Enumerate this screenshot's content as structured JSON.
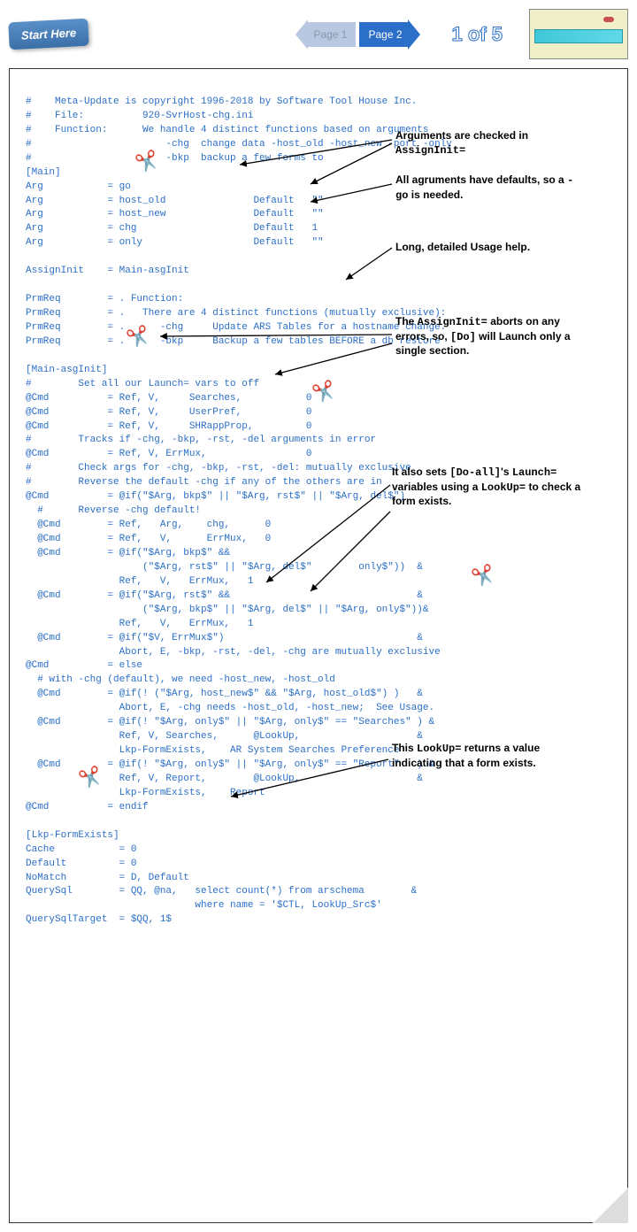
{
  "header": {
    "start_label": "Start Here",
    "page1_label": "Page 1",
    "page2_label": "Page 2",
    "counter": "1 of 5"
  },
  "code": "#    Meta-Update is copyright 1996-2018 by Software Tool House Inc.\n#    File:          920-SvrHost-chg.ini\n#    Function:      We handle 4 distinct functions based on arguments\n#                       -chg  change data -host_old -host_new -port -only\n#                       -bkp  backup a few forms to\n[Main]\nArg           = go\nArg           = host_old               Default   \"\"\nArg           = host_new               Default   \"\"\nArg           = chg                    Default   1\nArg           = only                   Default   \"\"\n\nAssignInit    = Main-asgInit\n\nPrmReq        = . Function:\nPrmReq        = .   There are 4 distinct functions (mutually exclusive):\nPrmReq        = .      -chg     Update ARS Tables for a hostname change.\nPrmReq        = .      -bkp     Backup a few tables BEFORE a db restore\n\n[Main-asgInit]\n#        Set all our Launch= vars to off\n@Cmd          = Ref, V,     Searches,           0\n@Cmd          = Ref, V,     UserPref,           0\n@Cmd          = Ref, V,     SHRappProp,         0\n#        Tracks if -chg, -bkp, -rst, -del arguments in error\n@Cmd          = Ref, V, ErrMux,                 0\n#        Check args for -chg, -bkp, -rst, -del: mutually exclusive\n#        Reverse the default -chg if any of the others are in\n@Cmd          = @if(\"$Arg, bkp$\" || \"$Arg, rst$\" || \"$Arg, del$\")\n  #      Reverse -chg default!\n  @Cmd        = Ref,   Arg,    chg,      0\n  @Cmd        = Ref,   V,      ErrMux,   0\n  @Cmd        = @if(\"$Arg, bkp$\" &&\n                    (\"$Arg, rst$\" || \"$Arg, del$\"        only$\"))  &\n                Ref,   V,   ErrMux,   1\n  @Cmd        = @if(\"$Arg, rst$\" &&                                &\n                    (\"$Arg, bkp$\" || \"$Arg, del$\" || \"$Arg, only$\"))&\n                Ref,   V,   ErrMux,   1\n  @Cmd        = @if(\"$V, ErrMux$\")                                 &\n                Abort, E, -bkp, -rst, -del, -chg are mutually exclusive\n@Cmd          = else\n  # with -chg (default), we need -host_new, -host_old\n  @Cmd        = @if(! (\"$Arg, host_new$\" && \"$Arg, host_old$\") )   &\n                Abort, E, -chg needs -host_old, -host_new;  See Usage.\n  @Cmd        = @if(! \"$Arg, only$\" || \"$Arg, only$\" == \"Searches\" ) &\n                Ref, V, Searches,      @LookUp,                    &\n                Lkp-FormExists,    AR System Searches Preference\n  @Cmd        = @if(! \"$Arg, only$\" || \"$Arg, only$\" == \"Report\"   ) &\n                Ref, V, Report,        @LookUp,                    &\n                Lkp-FormExists,    Report\n@Cmd          = endif\n\n[Lkp-FormExists]\nCache           = 0\nDefault         = 0\nNoMatch         = D, Default\nQuerySql        = QQ, @na,   select count(*) from arschema        &\n                             where name = '$CTL, LookUp_Src$'\nQuerySqlTarget  = $QQ, 1$",
  "annotations": {
    "a1": "Arguments are checked in",
    "a1b": "AssignInit=",
    "a2": "All agruments have defaults, so a ",
    "a2b": "-go",
    "a2c": " is needed.",
    "a3": "Long, detailed Usage help.",
    "a4a": "The ",
    "a4b": "AssignInit=",
    "a4c": " aborts on any errors, so, ",
    "a4d": "[Do]",
    "a4e": " will Launch only a single section.",
    "a5a": "It also sets ",
    "a5b": "[Do-all]",
    "a5c": "'s ",
    "a5d": "Launch=",
    "a5e": " variables using a ",
    "a5f": "LookUp=",
    "a5g": " to check a form exists.",
    "a6a": "This ",
    "a6b": "LookUp=",
    "a6c": " returns a value indicating that a form exists."
  }
}
